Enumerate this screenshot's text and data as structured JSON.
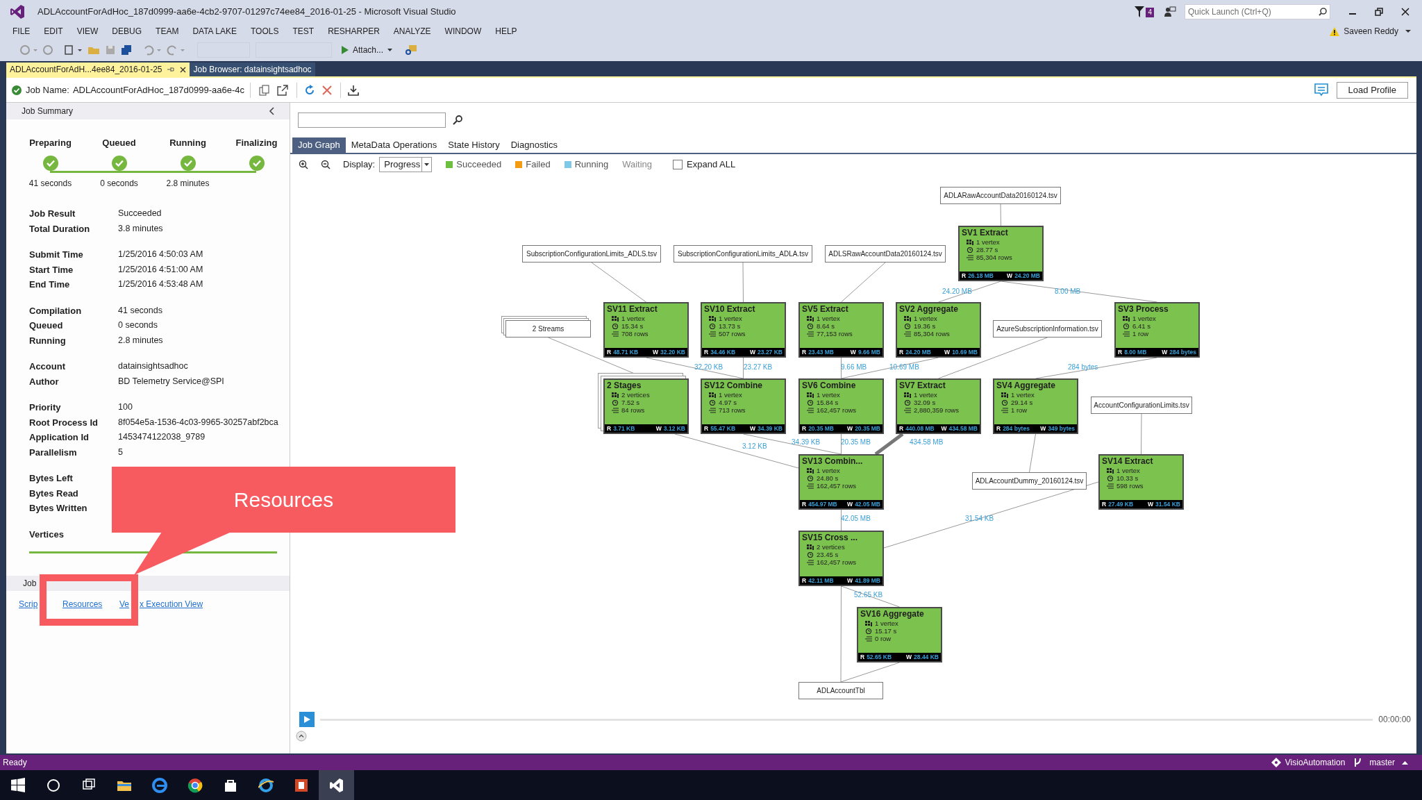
{
  "window": {
    "title": "ADLAccountForAdHoc_187d0999-aa6e-4cb2-9707-01297c74ee84_2016-01-25 - Microsoft Visual Studio",
    "notification_count": "4",
    "quick_launch": {
      "placeholder": "Quick Launch (Ctrl+Q)"
    },
    "user": "Saveen Reddy"
  },
  "menu": [
    "FILE",
    "EDIT",
    "VIEW",
    "DEBUG",
    "TEAM",
    "DATA LAKE",
    "TOOLS",
    "TEST",
    "RESHARPER",
    "ANALYZE",
    "WINDOW",
    "HELP"
  ],
  "toolbar": {
    "attach": "Attach..."
  },
  "document_tabs": [
    {
      "label": "ADLAccountForAdH...4ee84_2016-01-25",
      "selected": true
    },
    {
      "label": "Job Browser: datainsightsadhoc",
      "selected": false
    }
  ],
  "job_header": {
    "label": "Job Name:",
    "value": "ADLAccountForAdHoc_187d0999-aa6e-4c",
    "load_profile": "Load Profile"
  },
  "job_summary": {
    "title": "Job Summary",
    "steps": [
      {
        "label": "Preparing",
        "time": "41 seconds",
        "done": true
      },
      {
        "label": "Queued",
        "time": "0 seconds",
        "done": true
      },
      {
        "label": "Running",
        "time": "2.8 minutes",
        "done": true
      },
      {
        "label": "Finalizing",
        "done": true
      }
    ],
    "groups": [
      [
        {
          "label": "Job Result",
          "value": "Succeeded"
        },
        {
          "label": "Total Duration",
          "value": "3.8 minutes"
        }
      ],
      [
        {
          "label": "Submit Time",
          "value": "1/25/2016 4:50:03 AM"
        },
        {
          "label": "Start Time",
          "value": "1/25/2016 4:51:00 AM"
        },
        {
          "label": "End Time",
          "value": "1/25/2016 4:53:48 AM"
        }
      ],
      [
        {
          "label": "Compilation",
          "value": "41 seconds"
        },
        {
          "label": "Queued",
          "value": "0 seconds"
        },
        {
          "label": "Running",
          "value": "2.8 minutes"
        }
      ],
      [
        {
          "label": "Account",
          "value": "datainsightsadhoc"
        },
        {
          "label": "Author",
          "value": "BD Telemetry Service@SPI"
        }
      ],
      [
        {
          "label": "Priority",
          "value": "100"
        },
        {
          "label": "Root Process Id",
          "value": "8f054e5a-1536-4c03-9965-30257abf2bca"
        },
        {
          "label": "Application Id",
          "value": "1453474122038_9789"
        },
        {
          "label": "Parallelism",
          "value": "5"
        }
      ],
      [
        {
          "label": "Bytes Left"
        },
        {
          "label": "Bytes Read"
        },
        {
          "label": "Bytes Written"
        }
      ],
      [
        {
          "label": "Vertices"
        }
      ]
    ],
    "progress": {
      "level": 1
    },
    "details_title": [
      "Job"
    ],
    "links": [
      "Scrip",
      "Resources",
      "Ve",
      "x Execution View"
    ]
  },
  "tabs": [
    {
      "label": "Job Graph",
      "selected": true
    },
    {
      "label": "MetaData Operations",
      "selected": false
    },
    {
      "label": "State History",
      "selected": false
    },
    {
      "label": "Diagnostics",
      "selected": false
    }
  ],
  "display": {
    "label": "Display:",
    "value": "Progress"
  },
  "legend": [
    {
      "label": "Succeeded",
      "color": "#6cbf3f"
    },
    {
      "label": "Failed",
      "color": "#f39c12"
    },
    {
      "label": "Running",
      "color": "#7ec8e8"
    },
    {
      "label": "Waiting"
    }
  ],
  "expand_all": {
    "label": "Expand ALL",
    "checked": false
  },
  "graph": {
    "nodes": [
      {
        "kind": "file",
        "name": "ADLARawAccountData20160124.tsv"
      },
      {
        "kind": "file",
        "name": "SubscriptionConfigurationLimits_ADLS.tsv"
      },
      {
        "kind": "file",
        "name": "SubscriptionConfigurationLimits_ADLA.tsv"
      },
      {
        "kind": "file",
        "name": "ADLSRawAccountData20160124.tsv"
      },
      {
        "kind": "stage",
        "name": "SV1 Extract",
        "vertices": "1 vertex",
        "time": "28.77 s",
        "rows": "85,304 rows",
        "read_key": "R",
        "read": "26.18 MB",
        "write_key": "W",
        "written": "24.20 MB"
      },
      {
        "kind": "streams",
        "name": "2 Streams"
      },
      {
        "kind": "stage",
        "name": "SV11 Extract",
        "vertices": "1 vertex",
        "time": "15.34 s",
        "rows": "708 rows",
        "read_key": "R",
        "read": "48.71 KB",
        "write_key": "W",
        "written": "32.20 KB"
      },
      {
        "kind": "stage",
        "name": "SV10 Extract",
        "vertices": "1 vertex",
        "time": "13.73 s",
        "rows": "507 rows",
        "read_key": "R",
        "read": "34.46 KB",
        "write_key": "W",
        "written": "23.27 KB"
      },
      {
        "kind": "stage",
        "name": "SV5 Extract",
        "vertices": "1 vertex",
        "time": "8.64 s",
        "rows": "77,153 rows",
        "read_key": "R",
        "read": "23.43 MB",
        "write_key": "W",
        "written": "9.66 MB"
      },
      {
        "kind": "stage",
        "name": "SV2 Aggregate",
        "vertices": "1 vertex",
        "time": "19.36 s",
        "rows": "85,304 rows",
        "read_key": "R",
        "read": "24.20 MB",
        "write_key": "W",
        "written": "10.69 MB"
      },
      {
        "kind": "file",
        "name": "AzureSubscriptionInformation.tsv"
      },
      {
        "kind": "stage",
        "name": "SV3 Process",
        "vertices": "1 vertex",
        "time": "6.41 s",
        "rows": "1 row",
        "read_key": "R",
        "read": "8.00 MB",
        "write_key": "W",
        "written": "284 bytes"
      },
      {
        "kind": "stages",
        "name": "2 Stages",
        "vertices": "2 vertices",
        "time": "7.52 s",
        "rows": "84 rows",
        "read_key": "R",
        "read": "3.71 KB",
        "write_key": "W",
        "written": "3.12 KB"
      },
      {
        "kind": "stage",
        "name": "SV12 Combine",
        "vertices": "1 vertex",
        "time": "4.97 s",
        "rows": "713 rows",
        "read_key": "R",
        "read": "55.47 KB",
        "write_key": "W",
        "written": "34.39 KB"
      },
      {
        "kind": "stage",
        "name": "SV6 Combine",
        "vertices": "1 vertex",
        "time": "15.84 s",
        "rows": "162,457 rows",
        "read_key": "R",
        "read": "20.35 MB",
        "write_key": "W",
        "written": "20.35 MB"
      },
      {
        "kind": "stage",
        "name": "SV7 Extract",
        "vertices": "1 vertex",
        "time": "32.09 s",
        "rows": "2,880,359 rows",
        "read_key": "R",
        "read": "440.08 MB",
        "write_key": "W",
        "written": "434.58 MB"
      },
      {
        "kind": "stage",
        "name": "SV4 Aggregate",
        "vertices": "1 vertex",
        "time": "29.14 s",
        "rows": "1 row",
        "read_key": "R",
        "read": "284 bytes",
        "write_key": "W",
        "written": "349 bytes"
      },
      {
        "kind": "file",
        "name": "AccountConfigurationLimits.tsv"
      },
      {
        "kind": "stage",
        "name": "SV13 Combin...",
        "vertices": "1 vertex",
        "time": "24.80 s",
        "rows": "162,457 rows",
        "read_key": "R",
        "read": "454.97 MB",
        "write_key": "W",
        "written": "42.05 MB"
      },
      {
        "kind": "file",
        "name": "ADLAccountDummy_20160124.tsv"
      },
      {
        "kind": "stage",
        "name": "SV14 Extract",
        "vertices": "1 vertex",
        "time": "10.33 s",
        "rows": "598 rows",
        "read_key": "R",
        "read": "27.49 KB",
        "write_key": "W",
        "written": "31.54 KB"
      },
      {
        "kind": "stage",
        "name": "SV15 Cross ...",
        "vertices": "2 vertices",
        "time": "23.45 s",
        "rows": "162,457 rows",
        "read_key": "R",
        "read": "42.11 MB",
        "write_key": "W",
        "written": "41.89 MB"
      },
      {
        "kind": "stage",
        "name": "SV16 Aggregate",
        "vertices": "1 vertex",
        "time": "15.17 s",
        "rows": "0 row",
        "read_key": "R",
        "read": "52.65 KB",
        "write_key": "W",
        "written": "28.44 KB"
      },
      {
        "kind": "file",
        "name": "ADLAccountTbl"
      }
    ],
    "edge_labels": [
      "24.20 MB",
      "8.00 MB",
      "32.20 KB",
      "23.27 KB",
      "9.66 MB",
      "10.69 MB",
      "284 bytes",
      "3.12 KB",
      "34.39 KB",
      "20.35 MB",
      "434.58 MB",
      "42.05 MB",
      "31.54 KB",
      "52.65 KB"
    ]
  },
  "timeline": {
    "time": "00:00:00"
  },
  "status_bar": {
    "text": "Ready",
    "repo": "VisioAutomation",
    "branch": "master"
  },
  "annotation": {
    "text": "Resources"
  }
}
